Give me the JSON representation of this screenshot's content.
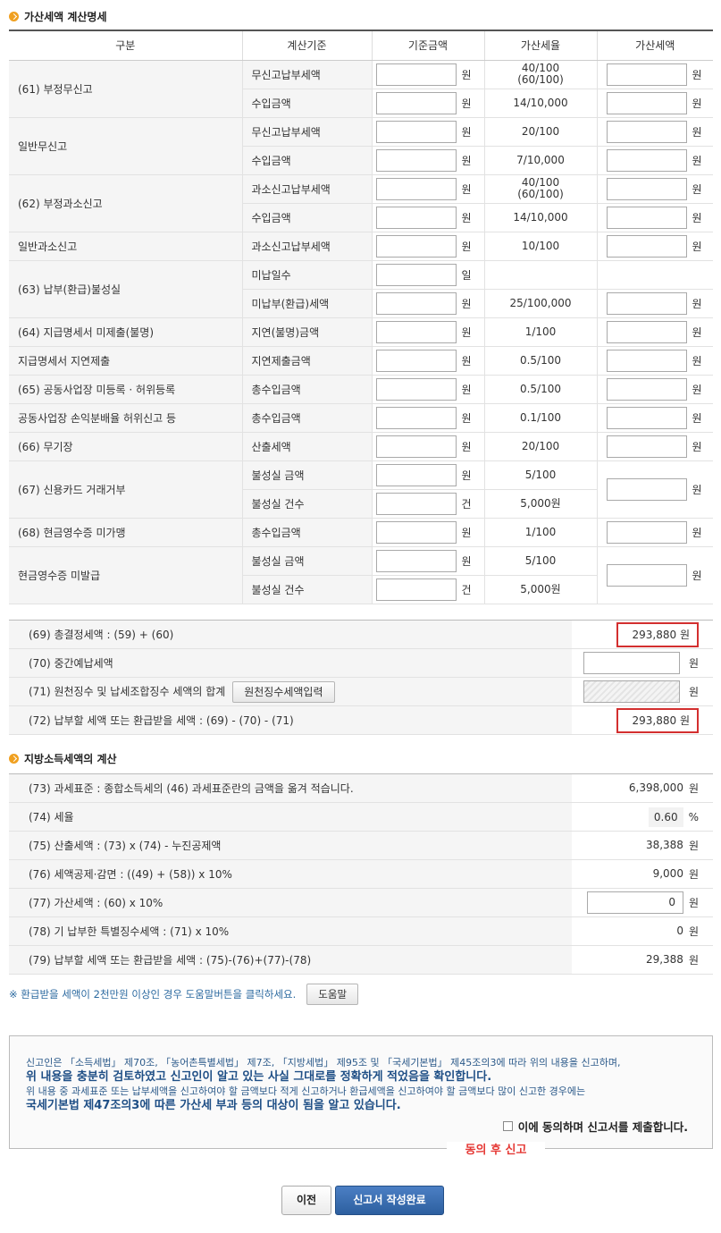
{
  "section1": {
    "title": "가산세액 계산명세"
  },
  "table1": {
    "headers": [
      "구분",
      "계산기준",
      "기준금액",
      "가산세율",
      "가산세액"
    ],
    "groups": [
      {
        "label": "(61) 부정무신고",
        "rows": [
          {
            "basis": "무신고납부세액",
            "unit": "원",
            "rate": "40/100",
            "rate2": "(60/100)"
          },
          {
            "basis": "수입금액",
            "unit": "원",
            "rate": "14/10,000"
          }
        ]
      },
      {
        "label": "일반무신고",
        "rows": [
          {
            "basis": "무신고납부세액",
            "unit": "원",
            "rate": "20/100"
          },
          {
            "basis": "수입금액",
            "unit": "원",
            "rate": "7/10,000"
          }
        ]
      },
      {
        "label": "(62) 부정과소신고",
        "rows": [
          {
            "basis": "과소신고납부세액",
            "unit": "원",
            "rate": "40/100",
            "rate2": "(60/100)"
          },
          {
            "basis": "수입금액",
            "unit": "원",
            "rate": "14/10,000"
          }
        ]
      },
      {
        "label": "일반과소신고",
        "rows": [
          {
            "basis": "과소신고납부세액",
            "unit": "원",
            "rate": "10/100"
          }
        ]
      },
      {
        "label": "(63) 납부(환급)불성실",
        "rows": [
          {
            "basis": "미납일수",
            "unit": "일",
            "rate": ""
          },
          {
            "basis": "미납부(환급)세액",
            "unit": "원",
            "rate": "25/100,000"
          }
        ]
      },
      {
        "label": "(64) 지급명세서 미제출(불명)",
        "rows": [
          {
            "basis": "지연(불명)금액",
            "unit": "원",
            "rate": "1/100"
          }
        ]
      },
      {
        "label": "지급명세서 지연제출",
        "rows": [
          {
            "basis": "지연제출금액",
            "unit": "원",
            "rate": "0.5/100"
          }
        ]
      },
      {
        "label": "(65) 공동사업장 미등록 · 허위등록",
        "rows": [
          {
            "basis": "총수입금액",
            "unit": "원",
            "rate": "0.5/100"
          }
        ]
      },
      {
        "label": "공동사업장 손익분배율 허위신고 등",
        "rows": [
          {
            "basis": "총수입금액",
            "unit": "원",
            "rate": "0.1/100"
          }
        ]
      },
      {
        "label": "(66) 무기장",
        "rows": [
          {
            "basis": "산출세액",
            "unit": "원",
            "rate": "20/100"
          }
        ]
      },
      {
        "label": "(67) 신용카드 거래거부",
        "rows": [
          {
            "basis": "불성실 금액",
            "unit": "원",
            "rate": "5/100"
          },
          {
            "basis": "불성실 건수",
            "unit": "건",
            "rate": "5,000원"
          }
        ]
      },
      {
        "label": "(68) 현금영수증 미가맹",
        "rows": [
          {
            "basis": "총수입금액",
            "unit": "원",
            "rate": "1/100"
          }
        ]
      },
      {
        "label": "현금영수증 미발급",
        "rows": [
          {
            "basis": "불성실 금액",
            "unit": "원",
            "rate": "5/100"
          },
          {
            "basis": "불성실 건수",
            "unit": "건",
            "rate": "5,000원"
          }
        ]
      }
    ],
    "penalty_unit": "원"
  },
  "table2": {
    "r69": {
      "label": "(69) 총결정세액 : (59) + (60)",
      "value": "293,880",
      "unit": "원"
    },
    "r70": {
      "label": "(70) 중간예납세액",
      "value": "",
      "unit": "원"
    },
    "r71": {
      "label": "(71) 원천징수 및 납세조합징수 세액의 합계",
      "button": "원천징수세액입력",
      "unit": "원"
    },
    "r72": {
      "label": "(72) 납부할 세액 또는 환급받을 세액 : (69) - (70) - (71)",
      "value": "293,880",
      "unit": "원"
    }
  },
  "section2": {
    "title": "지방소득세액의 계산"
  },
  "table3": {
    "rows": [
      {
        "label": "(73) 과세표준 : 종합소득세의 (46) 과세표준란의 금액을 옮겨 적습니다.",
        "value": "6,398,000",
        "unit": "원"
      },
      {
        "label": "(74) 세율",
        "value": "0.60",
        "unit": "%"
      },
      {
        "label": "(75) 산출세액 : (73) x (74) - 누진공제액",
        "value": "38,388",
        "unit": "원"
      },
      {
        "label": "(76) 세액공제·감면 : ((49) + (58)) x 10%",
        "value": "9,000",
        "unit": "원"
      },
      {
        "label": "(77) 가산세액 : (60) x 10%",
        "value": "0",
        "unit": "원"
      },
      {
        "label": "(78) 기 납부한 특별징수세액 : (71) x 10%",
        "value": "0",
        "unit": "원"
      },
      {
        "label": "(79) 납부할 세액 또는 환급받을 세액 : (75)-(76)+(77)-(78)",
        "value": "29,388",
        "unit": "원"
      }
    ]
  },
  "help": {
    "note": "※ 환급받을 세액이 2천만원 이상인 경우 도움말버튼을 클릭하세요.",
    "button": "도움말"
  },
  "notice": {
    "line1": "신고인은 「소득세법」 제70조, 「농어촌특별세법」 제7조, 「지방세법」 제95조 및 「국세기본법」 제45조의3에 따라 위의 내용을 신고하며,",
    "line2": "위 내용을 충분히 검토하였고 신고인이 알고 있는 사실 그대로를 정확하게 적었음을 확인합니다.",
    "line3": "위 내용 중 과세표준 또는 납부세액을 신고하여야 할 금액보다 적게 신고하거나 환급세액을 신고하여야 할 금액보다 많이 신고한 경우에는",
    "line4": "국세기본법 제47조의3에 따른 가산세 부과 등의 대상이 됨을 알고 있습니다.",
    "agree": "이에 동의하며 신고서를 제출합니다.",
    "after": "동의 후 신고"
  },
  "footer": {
    "prev": "이전",
    "submit": "신고서 작성완료"
  },
  "colors": {
    "highlight": "#d32f2f",
    "submit_bg": "#2d5f9f",
    "link_blue": "#2c6aa0"
  }
}
